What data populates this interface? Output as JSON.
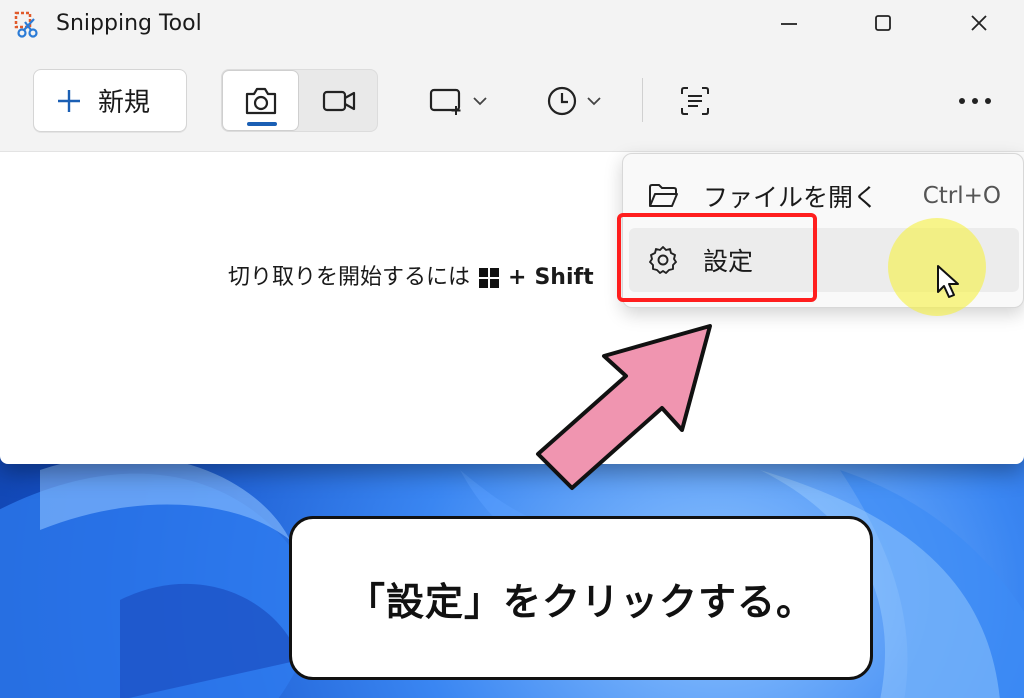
{
  "window": {
    "title": "Snipping Tool",
    "icons": {
      "app": "snipping-tool-icon",
      "minimize": "minimize-icon",
      "maximize": "maximize-icon",
      "close": "close-icon"
    }
  },
  "toolbar": {
    "new_label": "新規",
    "new_icon": "plus-icon",
    "mode_selected": "photo",
    "photo_icon": "camera-icon",
    "video_icon": "video-camera-icon",
    "shape_icon": "rectangle-snip-icon",
    "delay_icon": "clock-icon",
    "text_icon": "text-actions-icon",
    "more_icon": "more-dots-icon",
    "accent_color": "#1a5fb4"
  },
  "content": {
    "hint_prefix": "切り取りを開始するには",
    "hint_plus": "+",
    "hint_key": "Shift"
  },
  "menu": {
    "items": [
      {
        "label": "ファイルを開く",
        "shortcut": "Ctrl+O",
        "icon": "folder-open-icon"
      },
      {
        "label": "設定",
        "shortcut": "",
        "icon": "gear-icon"
      }
    ]
  },
  "annotation": {
    "caption": "「設定」をクリックする。",
    "highlight_color": "#ff1e1e",
    "arrow_color": "#f095b0"
  }
}
